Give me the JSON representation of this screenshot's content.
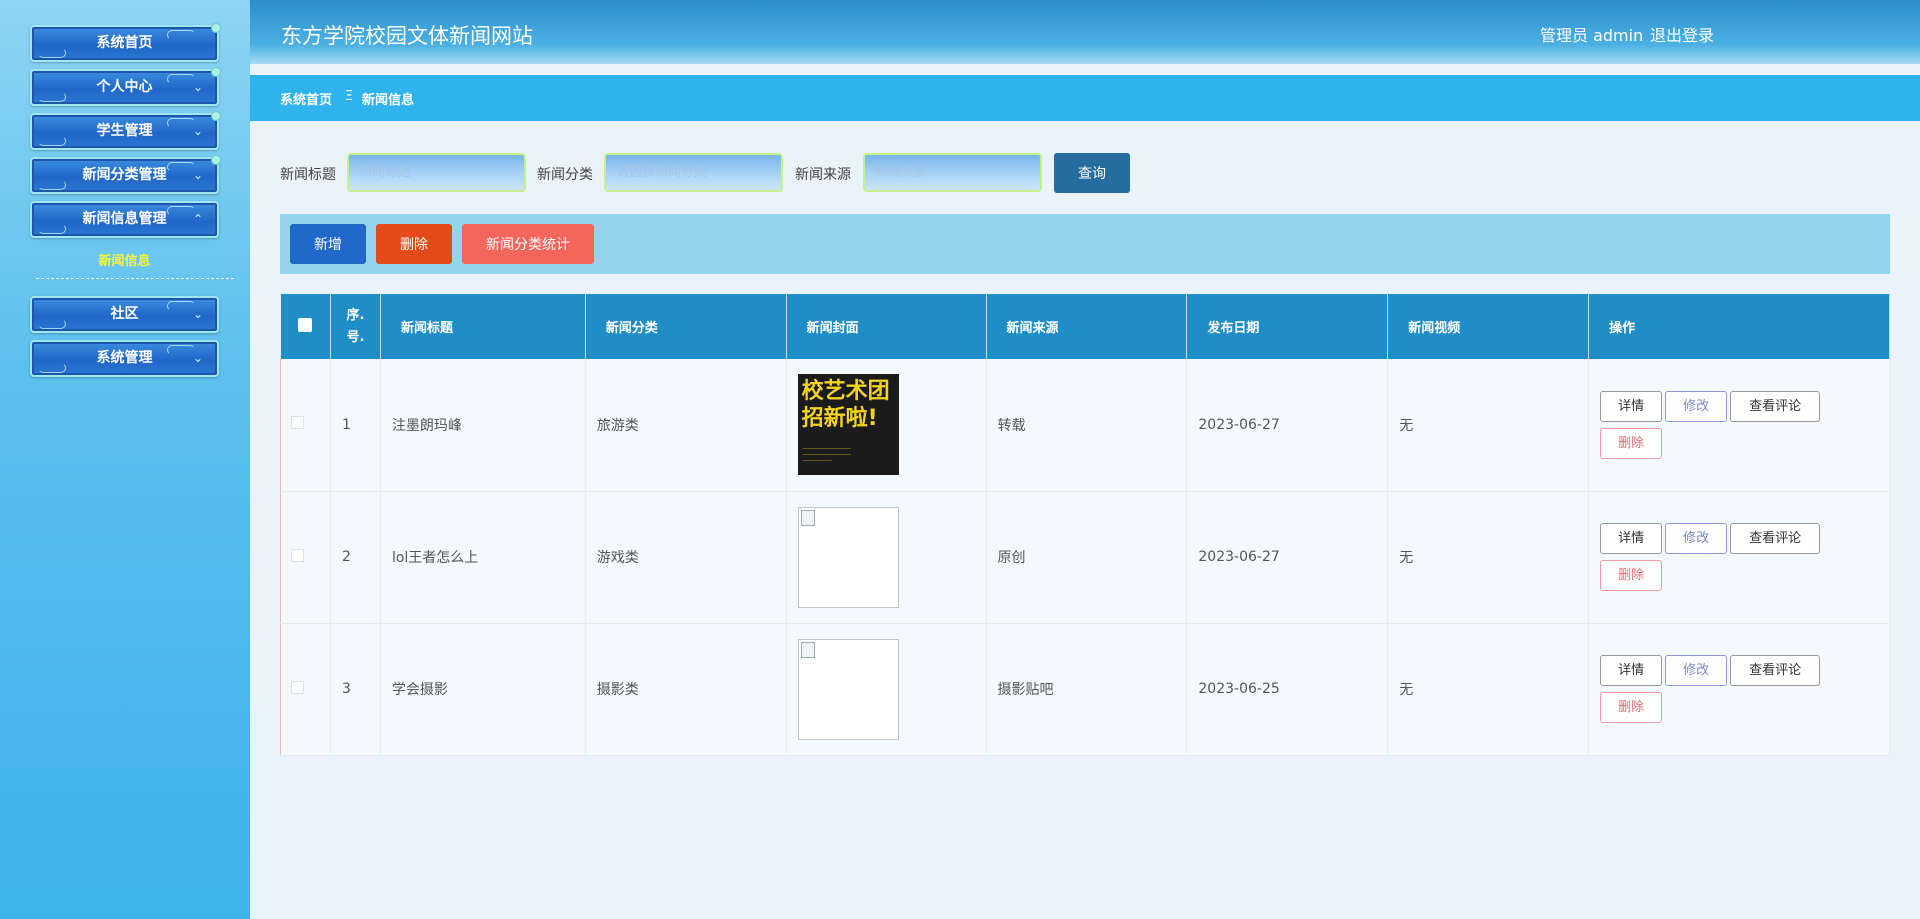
{
  "app": {
    "title": "东方学院校园文体新闻网站",
    "user": "管理员 admin",
    "logout": "退出登录"
  },
  "sidebar": {
    "items": [
      {
        "label": "系统首页"
      },
      {
        "label": "个人中心"
      },
      {
        "label": "学生管理"
      },
      {
        "label": "新闻分类管理"
      },
      {
        "label": "新闻信息管理"
      },
      {
        "label": "社区"
      },
      {
        "label": "系统管理"
      }
    ],
    "sub_item": "新闻信息"
  },
  "breadcrumb": {
    "home": "系统首页",
    "sep": "Ξ",
    "current": "新闻信息"
  },
  "search": {
    "title_label": "新闻标题",
    "title_placeholder": "新闻标题",
    "category_label": "新闻分类",
    "category_placeholder": "请选择新闻分类",
    "source_label": "新闻来源",
    "source_placeholder": "新闻来源",
    "query": "查询"
  },
  "actions": {
    "add": "新增",
    "delete": "删除",
    "stats": "新闻分类统计"
  },
  "table": {
    "columns": [
      "序号",
      "新闻标题",
      "新闻分类",
      "新闻封面",
      "新闻来源",
      "发布日期",
      "新闻视频",
      "操作"
    ],
    "index_label": "序.号.",
    "rows": [
      {
        "index": "1",
        "title": "注墨朗玛峰",
        "category": "旅游类",
        "source": "转载",
        "date": "2023-06-27",
        "video": "无"
      },
      {
        "index": "2",
        "title": "lol王者怎么上",
        "category": "游戏类",
        "source": "原创",
        "date": "2023-06-27",
        "video": "无"
      },
      {
        "index": "3",
        "title": "学会摄影",
        "category": "摄影类",
        "source": "摄影贴吧",
        "date": "2023-06-25",
        "video": "无"
      }
    ],
    "ops": {
      "detail": "详情",
      "edit": "修改",
      "comments": "查看评论",
      "delete": "删除"
    }
  },
  "poster": {
    "line1": "校艺术团",
    "line2": "招新啦!"
  },
  "colors": {
    "header": "#2a8fc9",
    "breadcrumb": "#2fb3ec",
    "add_button": "#2168c9",
    "delete_button": "#e34b1b",
    "stats_button": "#f4665c",
    "query_button": "#256d9e",
    "table_header": "#1f8ec7"
  }
}
